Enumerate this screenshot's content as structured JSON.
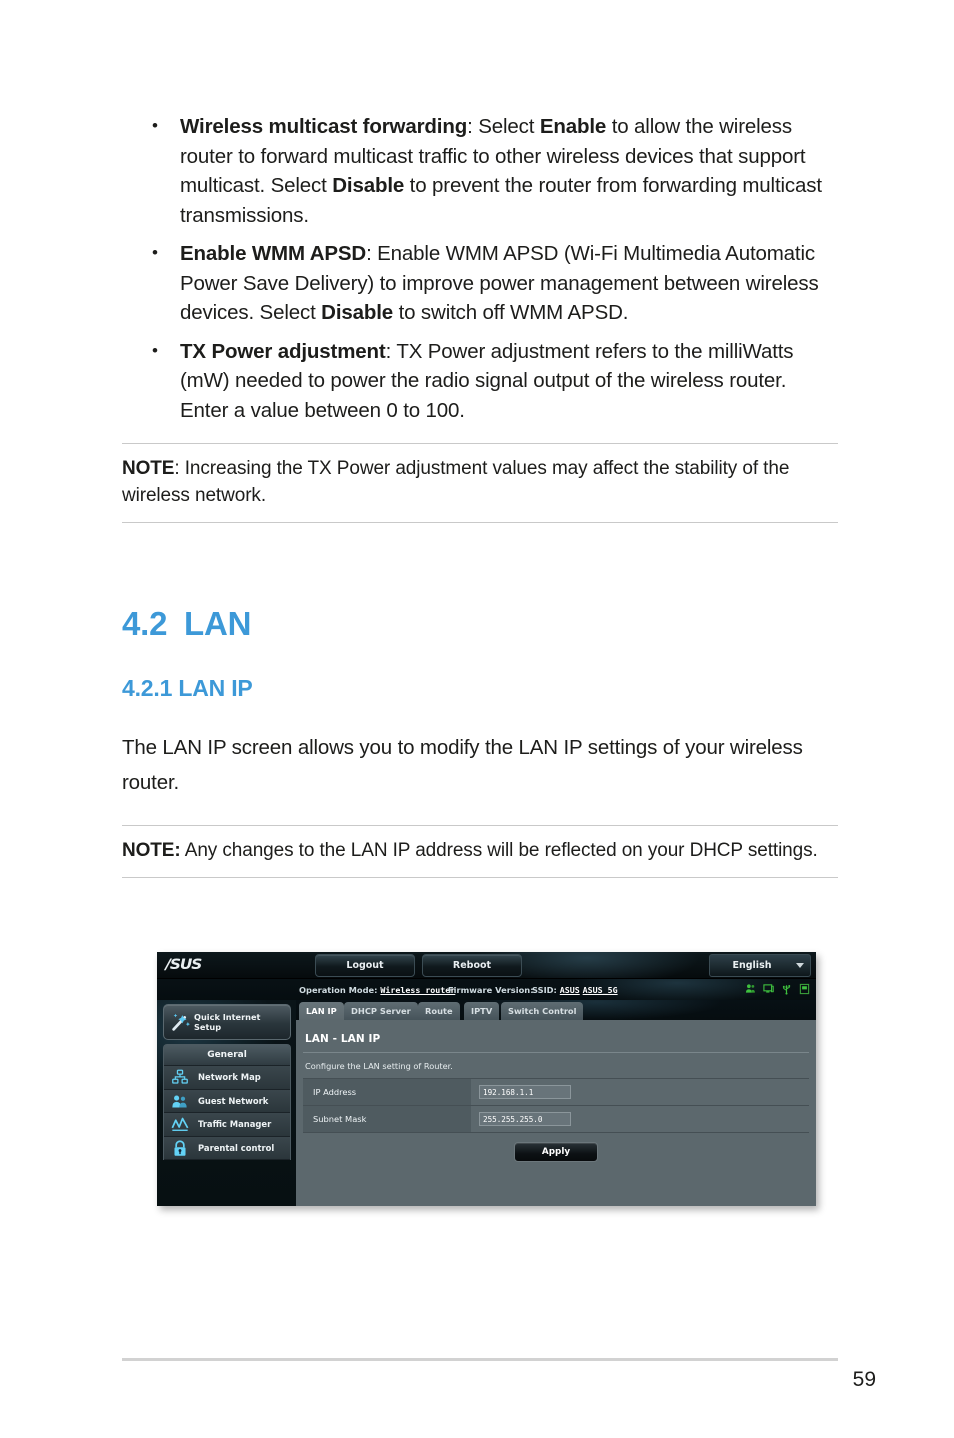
{
  "document": {
    "page_number": "59",
    "bullets": [
      {
        "term": "Wireless multicast forwarding",
        "text_1": ":  Select ",
        "em_1": "Enable",
        "text_2": " to allow the wireless router to forward multicast traffic to other wireless devices that support multicast. Select ",
        "em_2": "Disable",
        "text_3": " to prevent the router from forwarding multicast transmissions."
      },
      {
        "term": "Enable WMM APSD",
        "text_1": ":  Enable WMM APSD (Wi-Fi Multimedia Automatic Power Save Delivery) to improve power management between wireless devices. Select ",
        "em_1": "Disable",
        "text_2": " to switch off WMM APSD.",
        "em_2": "",
        "text_3": ""
      },
      {
        "term": "TX Power adjustment",
        "text_1": ":  TX Power adjustment refers to the milliWatts (mW) needed to power the radio signal output of the wireless router. Enter a value between 0 to 100.",
        "em_1": "",
        "text_2": "",
        "em_2": "",
        "text_3": ""
      }
    ],
    "note_1": {
      "label": "NOTE",
      "body": ":  Increasing the TX Power adjustment values may affect the stability of the wireless network."
    },
    "section_heading": {
      "number": "4.2",
      "title": "LAN"
    },
    "subsection_heading": "4.2.1 LAN IP",
    "paragraph": "The LAN IP screen allows you to modify the LAN IP settings of your wireless router.",
    "note_2": {
      "label": "NOTE:",
      "body": "  Any changes to the LAN IP address will be reflected on your DHCP settings."
    }
  },
  "router_ui": {
    "brand": "/SUS",
    "topbar": {
      "logout_label": "Logout",
      "reboot_label": "Reboot",
      "language_label": "English"
    },
    "status": {
      "operation_mode_label": "Operation Mode:",
      "operation_mode_value": "Wireless router",
      "firmware_label": "Firmware Version:",
      "firmware_value": "",
      "ssid_label": "SSID:",
      "ssid_1": "ASUS",
      "ssid_2": "ASUS_5G",
      "icons": [
        "clients-icon",
        "monitor-icon",
        "usb-icon",
        "printer-icon"
      ]
    },
    "sidebar": {
      "quick_setup": "Quick Internet Setup",
      "group_label": "General",
      "items": [
        {
          "label": "Network Map",
          "icon": "network-map-icon"
        },
        {
          "label": "Guest Network",
          "icon": "guest-network-icon"
        },
        {
          "label": "Traffic Manager",
          "icon": "traffic-manager-icon"
        },
        {
          "label": "Parental control",
          "icon": "parental-control-icon"
        }
      ]
    },
    "tabs": [
      {
        "label": "LAN IP",
        "active": true
      },
      {
        "label": "DHCP Server",
        "active": false
      },
      {
        "label": "Route",
        "active": false
      },
      {
        "label": "IPTV",
        "active": false
      },
      {
        "label": "Switch Control",
        "active": false
      }
    ],
    "panel": {
      "title": "LAN - LAN IP",
      "description": "Configure the LAN setting of Router.",
      "fields": [
        {
          "label": "IP Address",
          "value": "192.168.1.1"
        },
        {
          "label": "Subnet Mask",
          "value": "255.255.255.0"
        }
      ],
      "apply_label": "Apply"
    }
  },
  "colors": {
    "heading_blue": "#3d99d8",
    "body_text": "#1d1d1b",
    "rule_gray": "#c9c9c9",
    "panel_bg": "#5c686d",
    "status_icon_green": "#3fc13f"
  }
}
